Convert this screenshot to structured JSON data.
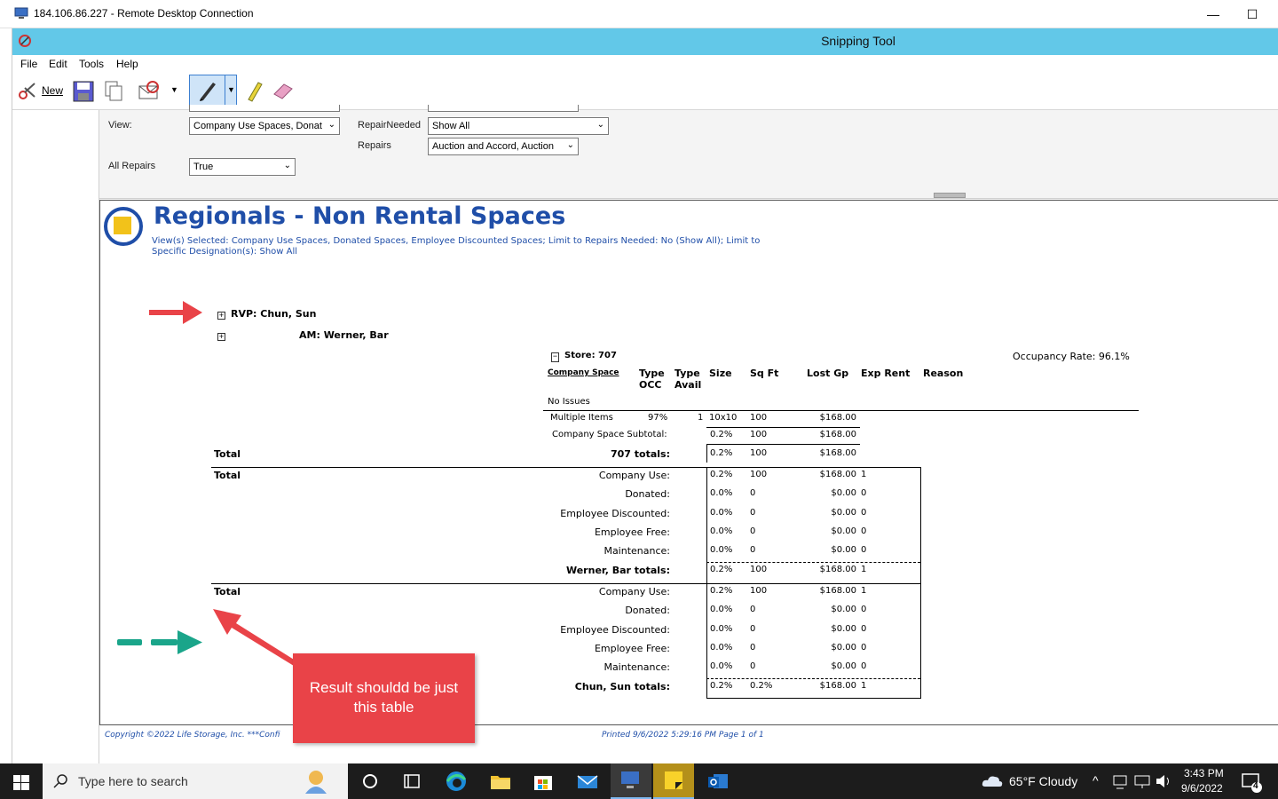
{
  "rdp": {
    "title": "184.106.86.227 - Remote Desktop Connection",
    "minimize": "—",
    "maximize": "☐"
  },
  "snip": {
    "title": "Snipping Tool",
    "menu": [
      "File",
      "Edit",
      "Tools",
      "Help"
    ],
    "new_label": "New"
  },
  "params": {
    "view_label": "View:",
    "view_value": "Company Use Spaces, Donat",
    "repair_needed_label": "RepairNeeded",
    "repair_needed_value": "Show All",
    "repairs_label": "Repairs",
    "repairs_value": "Auction and Accord, Auction",
    "all_repairs_label": "All Repairs",
    "all_repairs_value": "True"
  },
  "report": {
    "title": "Regionals - Non Rental Spaces",
    "subtitle": "View(s) Selected: Company Use Spaces, Donated Spaces, Employee Discounted Spaces; Limit to Repairs Needed: No (Show All); Limit to Specific Designation(s): Show All",
    "rvp": "RVP: Chun, Sun",
    "am": "AM: Werner, Bar",
    "store": "Store: 707",
    "occupancy": "Occupancy Rate: 96.1%",
    "columns": [
      "Company Space",
      "Type OCC",
      "Type Avail",
      "Size",
      "Sq Ft",
      "Lost Gp",
      "Exp Rent",
      "Reason"
    ],
    "col_type1": "Type",
    "col_occ": "OCC",
    "col_type2": "Type",
    "col_avail": "Avail",
    "no_issues": "No Issues",
    "item": {
      "name": "Multiple Items",
      "occ": "97%",
      "avail": "1",
      "size": "10x10",
      "sqft": "100",
      "lostgp": "$168.00"
    },
    "subtotal": {
      "label": "Company Space Subtotal:",
      "pct": "0.2%",
      "sqft": "100",
      "lostgp": "$168.00"
    },
    "store_total": {
      "total": "Total",
      "label": "707 totals:",
      "pct": "0.2%",
      "sqft": "100",
      "lostgp": "$168.00"
    },
    "am_block": {
      "total": "Total",
      "rows": [
        {
          "label": "Company Use:",
          "pct": "0.2%",
          "sqft": "100",
          "lostgp": "$168.00",
          "count": "1"
        },
        {
          "label": "Donated:",
          "pct": "0.0%",
          "sqft": "0",
          "lostgp": "$0.00",
          "count": "0"
        },
        {
          "label": "Employee Discounted:",
          "pct": "0.0%",
          "sqft": "0",
          "lostgp": "$0.00",
          "count": "0"
        },
        {
          "label": "Employee Free:",
          "pct": "0.0%",
          "sqft": "0",
          "lostgp": "$0.00",
          "count": "0"
        },
        {
          "label": "Maintenance:",
          "pct": "0.0%",
          "sqft": "0",
          "lostgp": "$0.00",
          "count": "0"
        },
        {
          "label": "Werner, Bar totals:",
          "pct": "0.2%",
          "sqft": "100",
          "lostgp": "$168.00",
          "count": "1"
        }
      ]
    },
    "rvp_block": {
      "total": "Total",
      "rows": [
        {
          "label": "Company Use:",
          "pct": "0.2%",
          "sqft": "100",
          "lostgp": "$168.00",
          "count": "1"
        },
        {
          "label": "Donated:",
          "pct": "0.0%",
          "sqft": "0",
          "lostgp": "$0.00",
          "count": "0"
        },
        {
          "label": "Employee Discounted:",
          "pct": "0.0%",
          "sqft": "0",
          "lostgp": "$0.00",
          "count": "0"
        },
        {
          "label": "Employee Free:",
          "pct": "0.0%",
          "sqft": "0",
          "lostgp": "$0.00",
          "count": "0"
        },
        {
          "label": "Maintenance:",
          "pct": "0.0%",
          "sqft": "0",
          "lostgp": "$0.00",
          "count": "0"
        },
        {
          "label": "Chun, Sun totals:",
          "pct": "0.2%",
          "sqft": "0.2%",
          "lostgp": "$168.00",
          "count": "1"
        }
      ]
    },
    "footer_left": "Copyright ©2022 Life Storage, Inc. ***Confi",
    "footer_right": "Printed 9/6/2022 5:29:16 PM    Page 1 of 1"
  },
  "callout": "Result  shouldd be just this table",
  "taskbar": {
    "search_placeholder": "Type here to search",
    "weather": "65°F  Cloudy",
    "time": "3:43 PM",
    "date": "9/6/2022",
    "notif_count": "4"
  },
  "colors": {
    "accent": "#62c8e8",
    "report_blue": "#1f4ea8",
    "callout_red": "#e94348",
    "arrow_green": "#1aa58a"
  }
}
